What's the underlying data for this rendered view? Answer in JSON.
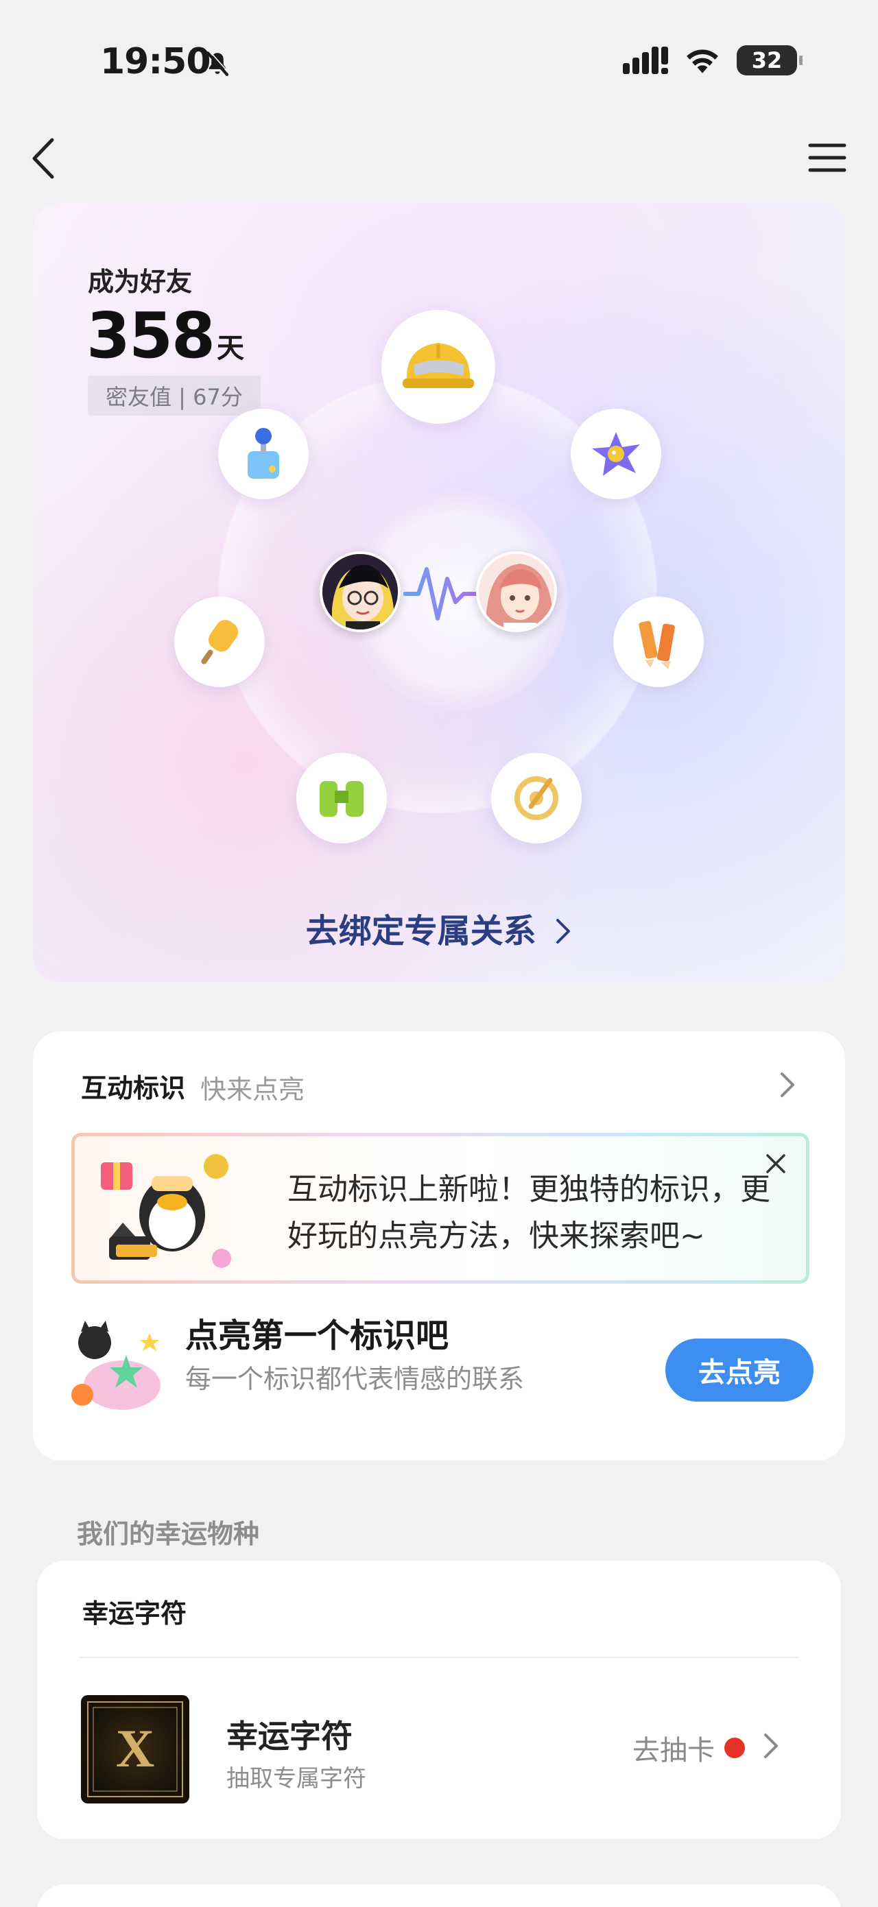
{
  "status_bar": {
    "time": "19:50",
    "battery": "32"
  },
  "nav": {
    "back_icon": "chevron-left-icon",
    "menu_icon": "hamburger-menu-icon"
  },
  "hero": {
    "label": "成为好友",
    "days": "358",
    "days_unit": "天",
    "intimacy": "密友值 | 67分",
    "bind_link": "去绑定专属关系",
    "badges": [
      "joystick",
      "helmet",
      "planet-star",
      "popsicle",
      "pencils",
      "binoculars",
      "target"
    ]
  },
  "interaction": {
    "title": "互动标识",
    "subtitle": "快来点亮",
    "banner_text": "互动标识上新啦！更独特的标识，更好玩的点亮方法，快来探索吧~",
    "light_title": "点亮第一个标识吧",
    "light_subtitle": "每一个标识都代表情感的联系",
    "light_button": "去点亮"
  },
  "lucky": {
    "section_title": "我们的幸运物种",
    "card_title": "幸运字符",
    "item_name": "幸运字符",
    "item_sub": "抽取专属字符",
    "action": "去抽卡",
    "rune_letter": "X"
  },
  "colors": {
    "accent_blue": "#3d8ef0",
    "link_navy": "#2c3e82",
    "red_dot": "#e83228",
    "page_bg": "#f1f1f3"
  }
}
